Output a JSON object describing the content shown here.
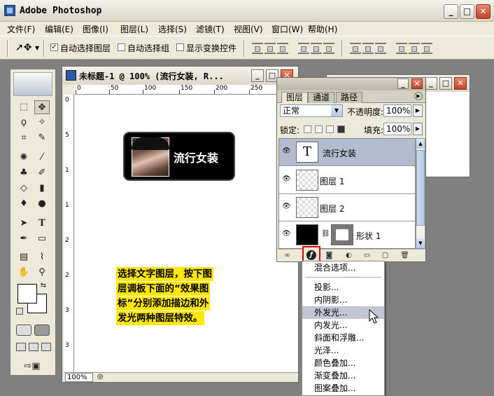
{
  "app": {
    "title": "Adobe Photoshop"
  },
  "window_controls": {
    "minimize": "_",
    "maximize": "□",
    "close": "✕"
  },
  "menubar": [
    "文件(F)",
    "编辑(E)",
    "图像(I)",
    "图层(L)",
    "选择(S)",
    "滤镜(T)",
    "视图(V)",
    "窗口(W)",
    "帮助(H)"
  ],
  "options": {
    "auto_select_layer": {
      "label": "自动选择图层",
      "checked": "✓"
    },
    "auto_select_group": {
      "label": "自动选择组"
    },
    "show_transform": {
      "label": "显示变换控件"
    }
  },
  "document": {
    "title": "未标题-1 @ 100% (流行女装, R...",
    "zoom": "100%",
    "ruler_h": [
      "0",
      "50",
      "100",
      "150",
      "200",
      "250"
    ],
    "ruler_v": [
      "0",
      "5",
      "1",
      "1",
      "2",
      "2",
      "3",
      "3"
    ],
    "badge_text": "流行女装",
    "note_lines": [
      "选择文字图层，按下图",
      "层调板下面的“效果图",
      "标”分别添加描边和外",
      "发光两种图层特效。"
    ]
  },
  "layers_panel": {
    "tabs": [
      "图层",
      "通道",
      "路径"
    ],
    "blend_mode": "正常",
    "opacity_label": "不透明度:",
    "opacity_value": "100%",
    "lock_label": "锁定:",
    "fill_label": "填充:",
    "fill_value": "100%",
    "layers": [
      {
        "name": "流行女装",
        "thumb": "T",
        "selected": true
      },
      {
        "name": "图层 1"
      },
      {
        "name": "图层 2"
      },
      {
        "name": "形状 1"
      }
    ]
  },
  "context_menu": {
    "items": [
      "混合选项...",
      "投影...",
      "内阴影...",
      "外发光...",
      "内发光...",
      "斜面和浮雕...",
      "光泽...",
      "颜色叠加...",
      "渐变叠加...",
      "图案叠加..."
    ],
    "hover_item": "外发光..."
  },
  "colors": {
    "highlight": "#ffe800",
    "selection": "#b3bbce",
    "fx_outline": "#e00000"
  }
}
